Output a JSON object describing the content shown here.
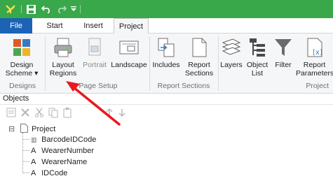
{
  "quick_access": {
    "app_icon": "app-logo-icon",
    "save_icon": "save-icon",
    "undo_icon": "undo-icon",
    "redo_icon": "redo-icon",
    "customize_icon": "customize-quick-access-icon"
  },
  "tabs": [
    {
      "label": "File"
    },
    {
      "label": "Start"
    },
    {
      "label": "Insert"
    },
    {
      "label": "Project"
    }
  ],
  "ribbon": {
    "designs_group": {
      "label": "Designs",
      "buttons": [
        {
          "label_line1": "Design",
          "label_line2": "Scheme ▾",
          "icon": "design-scheme-icon"
        }
      ]
    },
    "page_setup_group": {
      "label": "Page Setup",
      "buttons": [
        {
          "label_line1": "Layout",
          "label_line2": "Regions",
          "icon": "layout-regions-icon"
        },
        {
          "label_line1": "Portrait",
          "label_line2": "",
          "icon": "portrait-icon"
        },
        {
          "label_line1": "Landscape",
          "label_line2": "",
          "icon": "landscape-icon"
        }
      ]
    },
    "report_sections_group": {
      "label": "Report Sections",
      "buttons": [
        {
          "label_line1": "Includes",
          "label_line2": "",
          "icon": "includes-icon"
        },
        {
          "label_line1": "Report",
          "label_line2": "Sections",
          "icon": "report-sections-icon"
        }
      ]
    },
    "project_group": {
      "label": "Project",
      "buttons": [
        {
          "label_line1": "Layers",
          "label_line2": "",
          "icon": "layers-icon"
        },
        {
          "label_line1": "Object",
          "label_line2": "List",
          "icon": "object-list-icon"
        },
        {
          "label_line1": "Filter",
          "label_line2": "",
          "icon": "filter-icon"
        },
        {
          "label_line1": "Report",
          "label_line2": "Parameters",
          "icon": "report-parameters-icon"
        }
      ]
    }
  },
  "objects_pane": {
    "title": "Objects",
    "toolbar_icons": [
      "properties-icon",
      "delete-icon",
      "cut-icon",
      "copy-icon",
      "paste-icon",
      "move-up-icon",
      "move-down-icon"
    ],
    "tree": {
      "root": {
        "label": "Project",
        "expander": "⊟"
      },
      "children": [
        {
          "type_glyph": "▥",
          "label": "BarcodeIDCode",
          "icon": "barcode-icon"
        },
        {
          "type_glyph": "A",
          "label": "WearerNumber",
          "icon": "text-object-icon"
        },
        {
          "type_glyph": "A",
          "label": "WearerName",
          "icon": "text-object-icon"
        },
        {
          "type_glyph": "A",
          "label": "IDCode",
          "icon": "text-object-icon"
        }
      ]
    }
  },
  "colors": {
    "titlebar": "#38a84a",
    "file_tab": "#1c63b7",
    "ribbon_bg": "#f5f6f7",
    "annotation_arrow": "#e8191f"
  }
}
